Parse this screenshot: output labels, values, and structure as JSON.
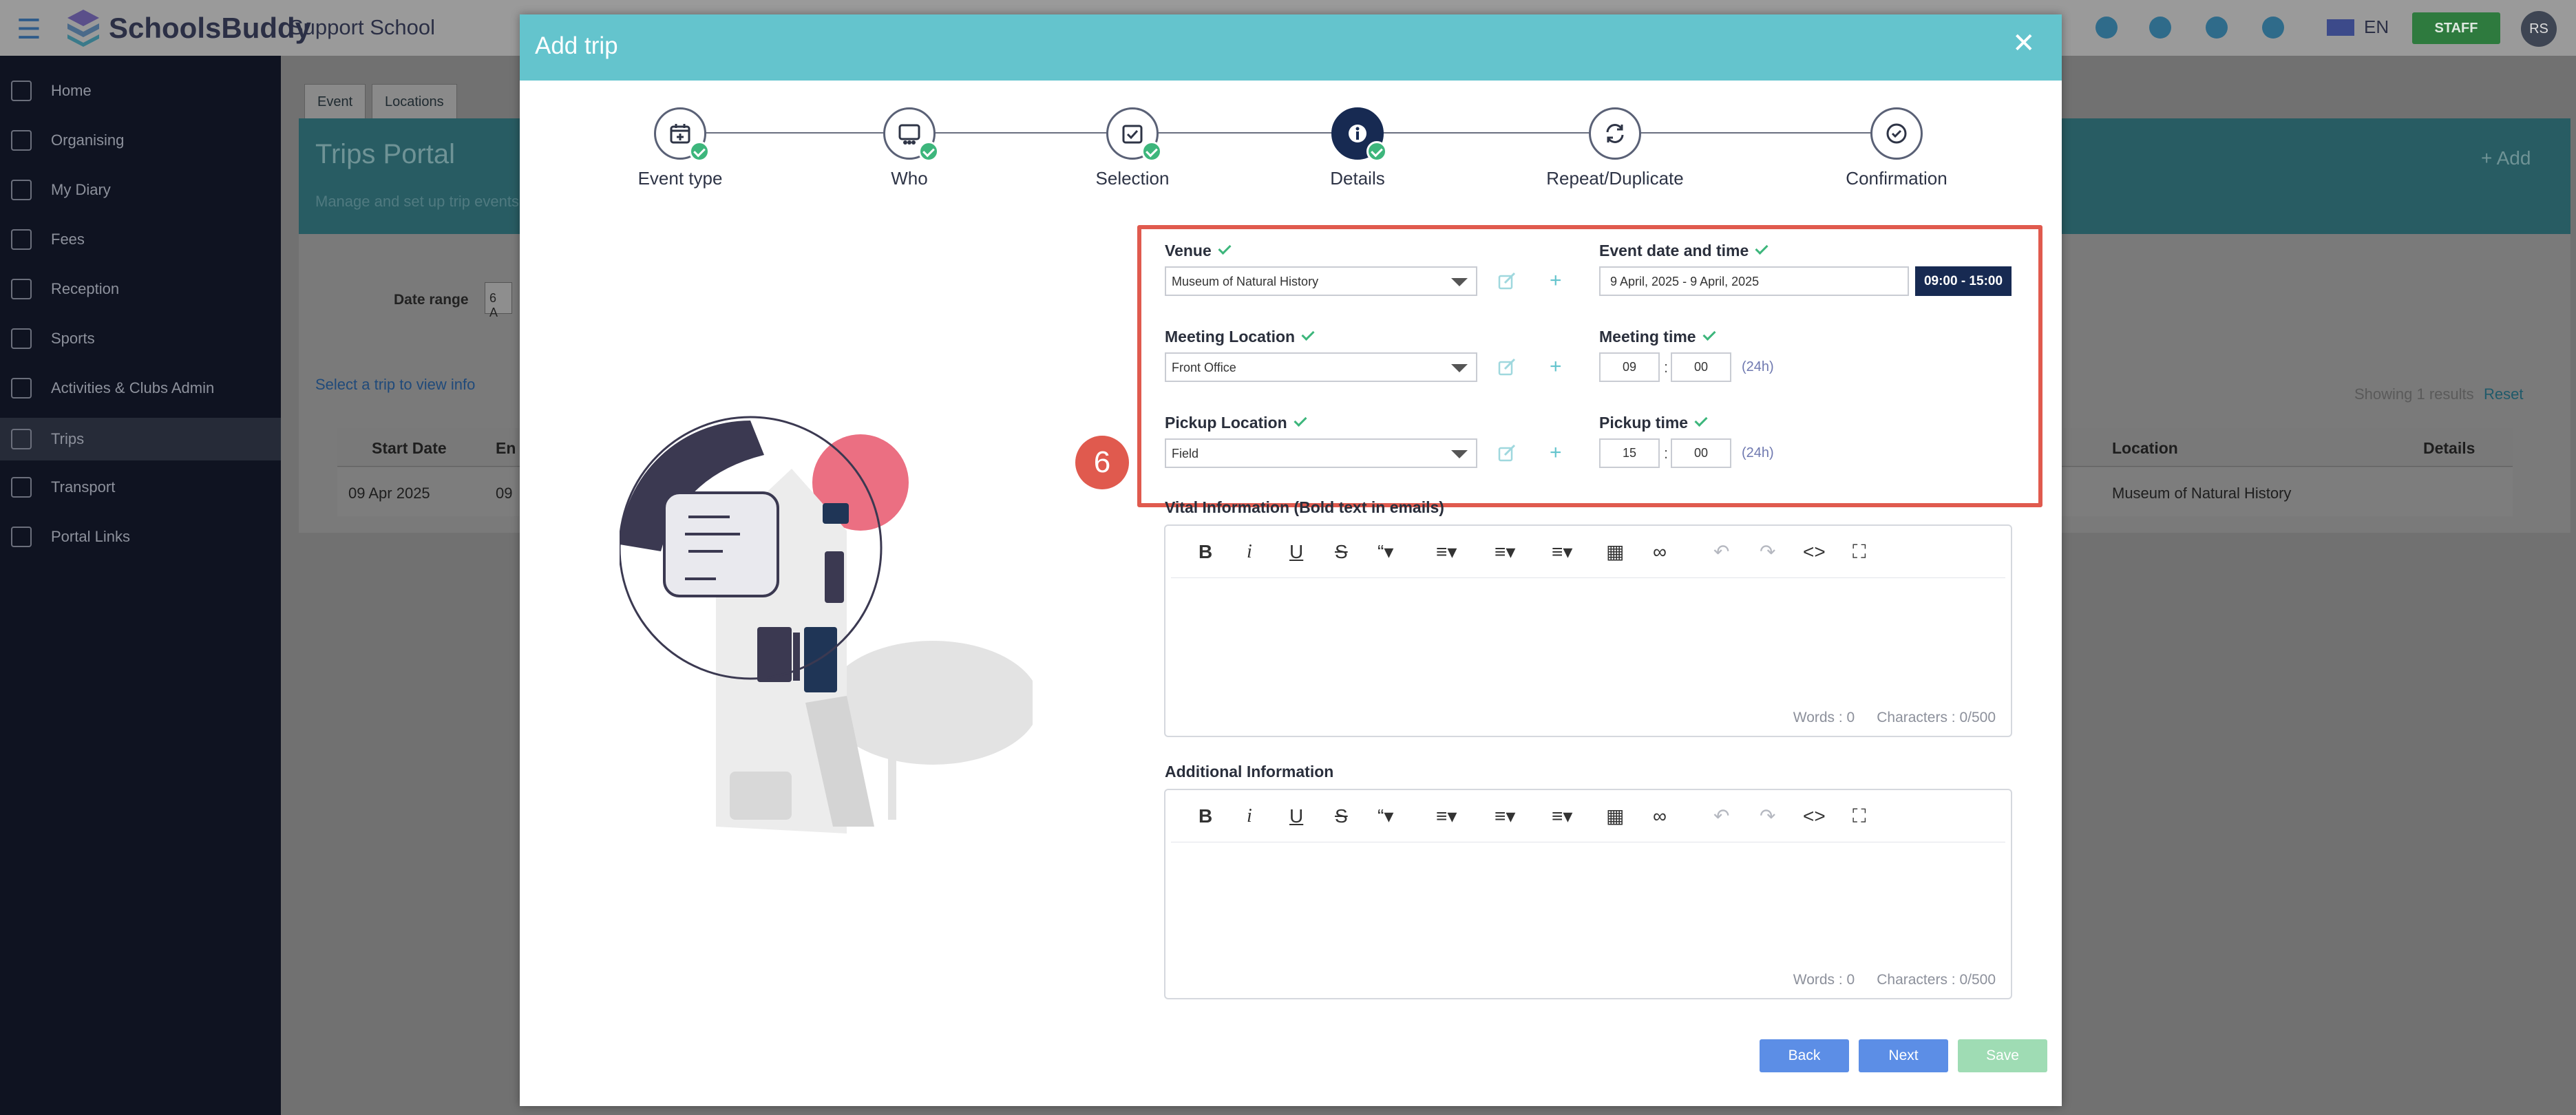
{
  "app": {
    "brand": "SchoolsBuddy",
    "school": "Support School",
    "language": "EN",
    "staff_label": "STAFF",
    "user_initials": "RS"
  },
  "sidebar": {
    "items": [
      {
        "label": "Home",
        "icon": "home-icon"
      },
      {
        "label": "Organising",
        "icon": "clipboard-icon"
      },
      {
        "label": "My Diary",
        "icon": "calendar-icon"
      },
      {
        "label": "Fees",
        "icon": "card-icon"
      },
      {
        "label": "Reception",
        "icon": "bell-icon"
      },
      {
        "label": "Sports",
        "icon": "bicycle-icon"
      },
      {
        "label": "Activities & Clubs Admin",
        "icon": "network-icon"
      },
      {
        "label": "Trips",
        "icon": "photo-icon"
      },
      {
        "label": "Transport",
        "icon": "bus-icon"
      },
      {
        "label": "Portal Links",
        "icon": "folder-icon"
      }
    ],
    "active_index": 7
  },
  "background": {
    "tabs": [
      "Event",
      "Locations"
    ],
    "portal_title": "Trips Portal",
    "portal_subtitle": "Manage and set up trip events",
    "add_label": "+ Add",
    "date_range_label": "Date range",
    "date_range_value": "6 A",
    "select_info": "Select a trip to view info",
    "showing": "Showing 1 results",
    "reset": "Reset",
    "table": {
      "headers": [
        "Start Date",
        "En",
        "Location",
        "Details"
      ],
      "row": {
        "start_date": "09 Apr 2025",
        "end_date": "09",
        "location": "Museum of Natural History"
      }
    }
  },
  "modal": {
    "title": "Add trip",
    "steps": [
      {
        "label": "Event type",
        "icon": "calendar-plus-icon",
        "completed": true
      },
      {
        "label": "Who",
        "icon": "people-icon",
        "completed": true
      },
      {
        "label": "Selection",
        "icon": "checkbox-icon",
        "completed": true
      },
      {
        "label": "Details",
        "icon": "info-icon",
        "completed": true,
        "current": true
      },
      {
        "label": "Repeat/Duplicate",
        "icon": "repeat-icon",
        "completed": false
      },
      {
        "label": "Confirmation",
        "icon": "check-circle-icon",
        "completed": false
      }
    ],
    "callout_number": "6",
    "venue": {
      "label": "Venue",
      "value": "Museum of Natural History"
    },
    "event_datetime": {
      "label": "Event date and time",
      "date_range": "9 April, 2025 - 9 April, 2025",
      "time_range": "09:00 - 15:00"
    },
    "meeting_location": {
      "label": "Meeting Location",
      "value": "Front Office"
    },
    "meeting_time": {
      "label": "Meeting time",
      "hour": "09",
      "minute": "00",
      "format": "(24h)"
    },
    "pickup_location": {
      "label": "Pickup Location",
      "value": "Field"
    },
    "pickup_time": {
      "label": "Pickup time",
      "hour": "15",
      "minute": "00",
      "format": "(24h)"
    },
    "vital_info": {
      "label": "Vital Information (Bold text in emails)",
      "words": "Words : 0",
      "characters": "Characters : 0/500"
    },
    "additional_info": {
      "label": "Additional Information",
      "words": "Words : 0",
      "characters": "Characters : 0/500"
    },
    "buttons": {
      "back": "Back",
      "next": "Next",
      "save": "Save"
    }
  },
  "colors": {
    "header": "#64c4cd",
    "primary_button": "#5c8ee6",
    "save_button": "#9fdcb4",
    "highlight": "#e05a4e",
    "success": "#3db67c",
    "current_step": "#172a52"
  }
}
